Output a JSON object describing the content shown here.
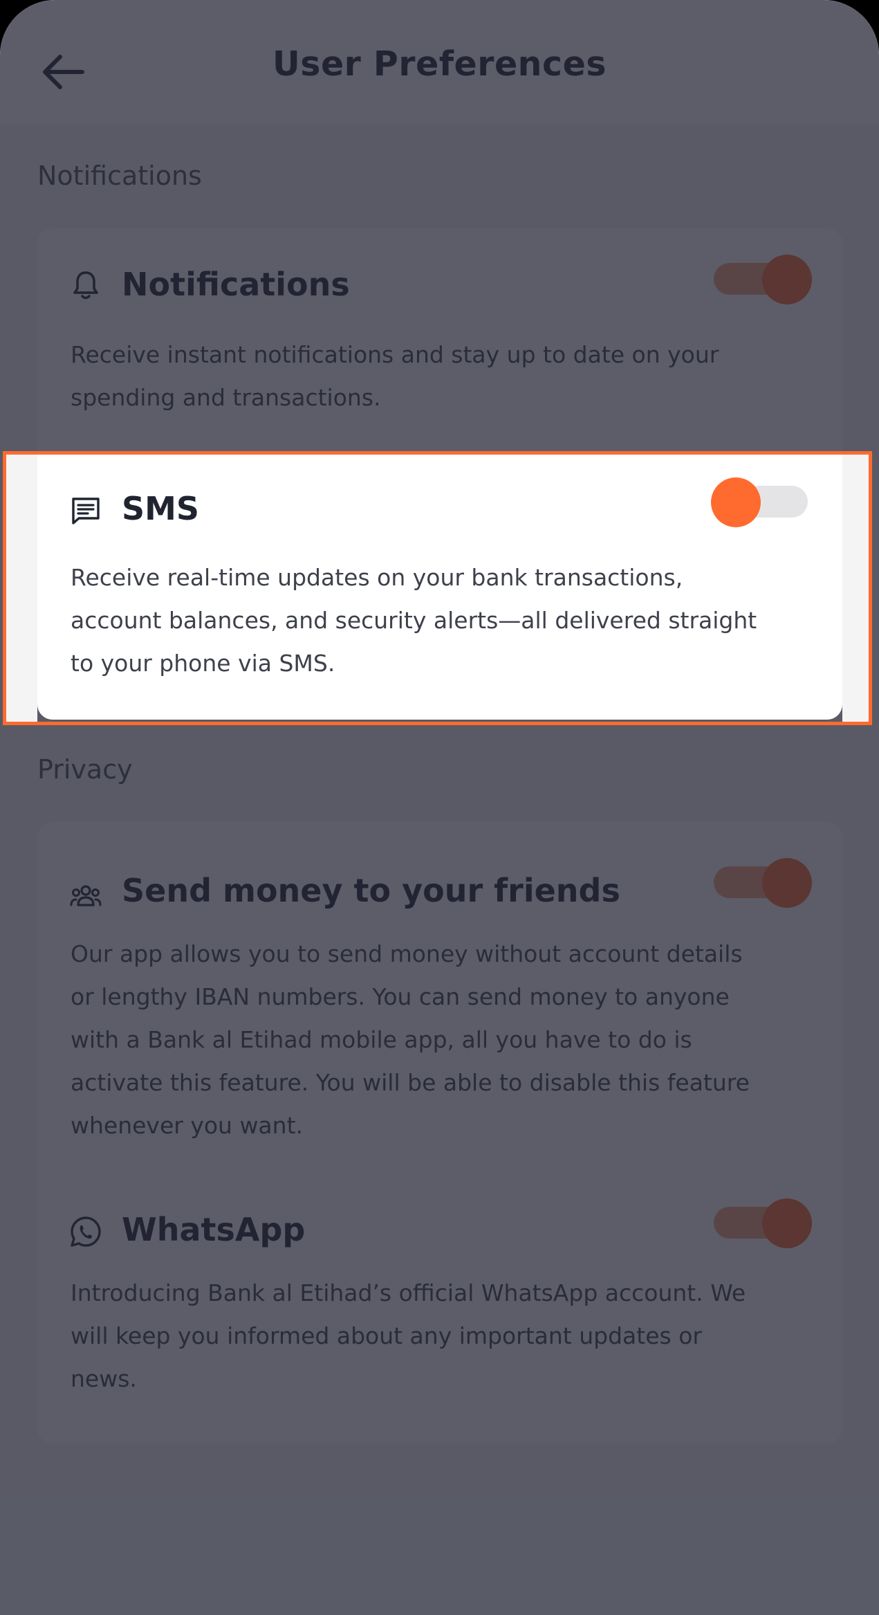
{
  "header": {
    "title": "User Preferences",
    "back_icon": "arrow-left-icon"
  },
  "sections": [
    {
      "title": "Notifications",
      "items": [
        {
          "icon": "bell-icon",
          "title": "Notifications",
          "description": "Receive instant notifications and stay up to date on your spending and transactions.",
          "enabled": true
        },
        {
          "icon": "message-icon",
          "title": "SMS",
          "description": "Receive real-time updates on your bank transactions, account balances, and security alerts—all delivered straight to your phone via SMS.",
          "enabled": false
        }
      ]
    },
    {
      "title": "Privacy",
      "items": [
        {
          "icon": "people-icon",
          "title": "Send money to your friends",
          "description": "Our app allows you to send money without account details or lengthy IBAN numbers. You can send money to anyone with a Bank al Etihad mobile app, all you have to do is activate this feature. You will be able to disable this feature whenever you want.",
          "enabled": true
        },
        {
          "icon": "whatsapp-icon",
          "title": "WhatsApp",
          "description": "Introducing Bank al Etihad’s official WhatsApp account. We will keep you informed about any important updates or news.",
          "enabled": true
        }
      ]
    }
  ],
  "colors": {
    "accent": "#ff6a2f",
    "toggle_track_on": "#f8a27a",
    "toggle_track_off": "#e4e4e6",
    "overlay": "#232534"
  }
}
